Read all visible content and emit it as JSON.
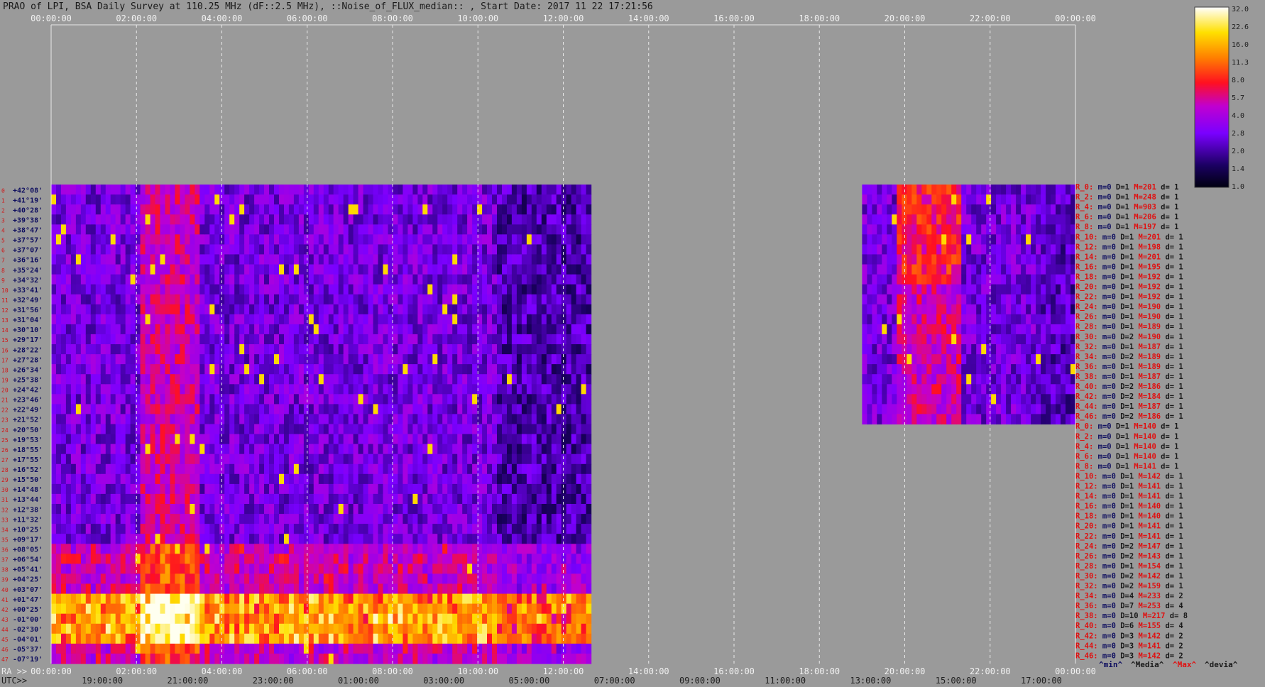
{
  "title": "PRAO of LPI, BSA Daily Survey at 110.25 MHz (dF::2.5 MHz), ::Noise_of_FLUX_median:: , Start Date: 2017 11 22 17:21:56",
  "colors": {
    "background": "#9a9a9a",
    "data_low": "#000010",
    "data_mid": "#8a00ff",
    "data_high": "#ff1010",
    "data_peak": "#ffffe0",
    "label_blue": "#101060",
    "label_red": "#e01010"
  },
  "chart_data": {
    "type": "heatmap",
    "title": "PRAO of LPI, BSA Daily Survey at 110.25 MHz (dF::2.5 MHz), ::Noise_of_FLUX_median:: , Start Date: 2017 11 22 17:21:56",
    "x_top_ticks": [
      "00:00:00",
      "02:00:00",
      "04:00:00",
      "06:00:00",
      "08:00:00",
      "10:00:00",
      "12:00:00",
      "14:00:00",
      "16:00:00",
      "18:00:00",
      "20:00:00",
      "22:00:00",
      "00:00:00"
    ],
    "x_ra_label": "RA >>",
    "x_ra_ticks": [
      "00:00:00",
      "02:00:00",
      "04:00:00",
      "06:00:00",
      "08:00:00",
      "10:00:00",
      "12:00:00",
      "14:00:00",
      "16:00:00",
      "18:00:00",
      "20:00:00",
      "22:00:00",
      "00:00:00"
    ],
    "x_utc_label": "UTC>>",
    "x_utc_ticks": [
      "19:00:00",
      "21:00:00",
      "23:00:00",
      "01:00:00",
      "03:00:00",
      "05:00:00",
      "07:00:00",
      "09:00:00",
      "11:00:00",
      "13:00:00",
      "15:00:00",
      "17:00:00"
    ],
    "x_range_hours": [
      0,
      24
    ],
    "data_segments_hours": [
      [
        0,
        12.65
      ],
      [
        19.0,
        24.0
      ]
    ],
    "y_dec_labels": [
      "+42°08'",
      "+41°19'",
      "+40°28'",
      "+39°38'",
      "+38°47'",
      "+37°57'",
      "+37°07'",
      "+36°16'",
      "+35°24'",
      "+34°32'",
      "+33°41'",
      "+32°49'",
      "+31°56'",
      "+31°04'",
      "+30°10'",
      "+29°17'",
      "+28°22'",
      "+27°28'",
      "+26°34'",
      "+25°38'",
      "+24°42'",
      "+23°46'",
      "+22°49'",
      "+21°52'",
      "+20°50'",
      "+19°53'",
      "+18°55'",
      "+17°55'",
      "+16°52'",
      "+15°50'",
      "+14°48'",
      "+13°44'",
      "+12°38'",
      "+11°32'",
      "+10°25'",
      "+09°17'",
      "+08°05'",
      "+06°54'",
      "+05°41'",
      "+04°25'",
      "+03°07'",
      "+01°47'",
      "+00°25'",
      "-01°00'",
      "-02°30'",
      "-04°01'",
      "-05°37'",
      "-07°19'"
    ],
    "colorbar": {
      "ticks": [
        "32.0",
        "22.6",
        "16.0",
        "11.3",
        "8.0",
        "5.7",
        "4.0",
        "2.8",
        "2.0",
        "1.4",
        "1.0"
      ],
      "range": [
        1.0,
        32.0
      ],
      "scale": "log"
    },
    "stats_legend": [
      "^min^",
      "^Media^",
      "^Max^",
      "^devia^"
    ],
    "stats": [
      {
        "r": "R_0:",
        "m": "m=0",
        "D": "D=1",
        "M": "M=201",
        "d": "d= 1"
      },
      {
        "r": "R_2:",
        "m": "m=0",
        "D": "D=1",
        "M": "M=248",
        "d": "d= 1"
      },
      {
        "r": "R_4:",
        "m": "m=0",
        "D": "D=1",
        "M": "M=903",
        "d": "d= 1"
      },
      {
        "r": "R_6:",
        "m": "m=0",
        "D": "D=1",
        "M": "M=206",
        "d": "d= 1"
      },
      {
        "r": "R_8:",
        "m": "m=0",
        "D": "D=1",
        "M": "M=197",
        "d": "d= 1"
      },
      {
        "r": "R_10:",
        "m": "m=0",
        "D": "D=1",
        "M": "M=201",
        "d": "d= 1"
      },
      {
        "r": "R_12:",
        "m": "m=0",
        "D": "D=1",
        "M": "M=198",
        "d": "d= 1"
      },
      {
        "r": "R_14:",
        "m": "m=0",
        "D": "D=1",
        "M": "M=201",
        "d": "d= 1"
      },
      {
        "r": "R_16:",
        "m": "m=0",
        "D": "D=1",
        "M": "M=195",
        "d": "d= 1"
      },
      {
        "r": "R_18:",
        "m": "m=0",
        "D": "D=1",
        "M": "M=192",
        "d": "d= 1"
      },
      {
        "r": "R_20:",
        "m": "m=0",
        "D": "D=1",
        "M": "M=192",
        "d": "d= 1"
      },
      {
        "r": "R_22:",
        "m": "m=0",
        "D": "D=1",
        "M": "M=192",
        "d": "d= 1"
      },
      {
        "r": "R_24:",
        "m": "m=0",
        "D": "D=1",
        "M": "M=190",
        "d": "d= 1"
      },
      {
        "r": "R_26:",
        "m": "m=0",
        "D": "D=1",
        "M": "M=190",
        "d": "d= 1"
      },
      {
        "r": "R_28:",
        "m": "m=0",
        "D": "D=1",
        "M": "M=189",
        "d": "d= 1"
      },
      {
        "r": "R_30:",
        "m": "m=0",
        "D": "D=2",
        "M": "M=190",
        "d": "d= 1"
      },
      {
        "r": "R_32:",
        "m": "m=0",
        "D": "D=1",
        "M": "M=187",
        "d": "d= 1"
      },
      {
        "r": "R_34:",
        "m": "m=0",
        "D": "D=2",
        "M": "M=189",
        "d": "d= 1"
      },
      {
        "r": "R_36:",
        "m": "m=0",
        "D": "D=1",
        "M": "M=189",
        "d": "d= 1"
      },
      {
        "r": "R_38:",
        "m": "m=0",
        "D": "D=1",
        "M": "M=187",
        "d": "d= 1"
      },
      {
        "r": "R_40:",
        "m": "m=0",
        "D": "D=2",
        "M": "M=186",
        "d": "d= 1"
      },
      {
        "r": "R_42:",
        "m": "m=0",
        "D": "D=2",
        "M": "M=184",
        "d": "d= 1"
      },
      {
        "r": "R_44:",
        "m": "m=0",
        "D": "D=1",
        "M": "M=187",
        "d": "d= 1"
      },
      {
        "r": "R_46:",
        "m": "m=0",
        "D": "D=2",
        "M": "M=186",
        "d": "d= 1"
      },
      {
        "r": "R_0:",
        "m": "m=0",
        "D": "D=1",
        "M": "M=140",
        "d": "d= 1"
      },
      {
        "r": "R_2:",
        "m": "m=0",
        "D": "D=1",
        "M": "M=140",
        "d": "d= 1"
      },
      {
        "r": "R_4:",
        "m": "m=0",
        "D": "D=1",
        "M": "M=140",
        "d": "d= 1"
      },
      {
        "r": "R_6:",
        "m": "m=0",
        "D": "D=1",
        "M": "M=140",
        "d": "d= 1"
      },
      {
        "r": "R_8:",
        "m": "m=0",
        "D": "D=1",
        "M": "M=141",
        "d": "d= 1"
      },
      {
        "r": "R_10:",
        "m": "m=0",
        "D": "D=1",
        "M": "M=142",
        "d": "d= 1"
      },
      {
        "r": "R_12:",
        "m": "m=0",
        "D": "D=1",
        "M": "M=141",
        "d": "d= 1"
      },
      {
        "r": "R_14:",
        "m": "m=0",
        "D": "D=1",
        "M": "M=141",
        "d": "d= 1"
      },
      {
        "r": "R_16:",
        "m": "m=0",
        "D": "D=1",
        "M": "M=140",
        "d": "d= 1"
      },
      {
        "r": "R_18:",
        "m": "m=0",
        "D": "D=1",
        "M": "M=140",
        "d": "d= 1"
      },
      {
        "r": "R_20:",
        "m": "m=0",
        "D": "D=1",
        "M": "M=141",
        "d": "d= 1"
      },
      {
        "r": "R_22:",
        "m": "m=0",
        "D": "D=1",
        "M": "M=141",
        "d": "d= 1"
      },
      {
        "r": "R_24:",
        "m": "m=0",
        "D": "D=2",
        "M": "M=147",
        "d": "d= 1"
      },
      {
        "r": "R_26:",
        "m": "m=0",
        "D": "D=2",
        "M": "M=143",
        "d": "d= 1"
      },
      {
        "r": "R_28:",
        "m": "m=0",
        "D": "D=1",
        "M": "M=154",
        "d": "d= 1"
      },
      {
        "r": "R_30:",
        "m": "m=0",
        "D": "D=2",
        "M": "M=142",
        "d": "d= 1"
      },
      {
        "r": "R_32:",
        "m": "m=0",
        "D": "D=2",
        "M": "M=159",
        "d": "d= 1"
      },
      {
        "r": "R_34:",
        "m": "m=0",
        "D": "D=4",
        "M": "M=233",
        "d": "d= 2"
      },
      {
        "r": "R_36:",
        "m": "m=0",
        "D": "D=7",
        "M": "M=253",
        "d": "d= 4"
      },
      {
        "r": "R_38:",
        "m": "m=0",
        "D": "D=10",
        "M": "M=217",
        "d": "d= 8"
      },
      {
        "r": "R_40:",
        "m": "m=0",
        "D": "D=6",
        "M": "M=155",
        "d": "d= 4"
      },
      {
        "r": "R_42:",
        "m": "m=0",
        "D": "D=3",
        "M": "M=142",
        "d": "d= 2"
      },
      {
        "r": "R_44:",
        "m": "m=0",
        "D": "D=3",
        "M": "M=141",
        "d": "d= 2"
      },
      {
        "r": "R_46:",
        "m": "m=0",
        "D": "D=3",
        "M": "M=142",
        "d": "d= 2"
      }
    ]
  }
}
